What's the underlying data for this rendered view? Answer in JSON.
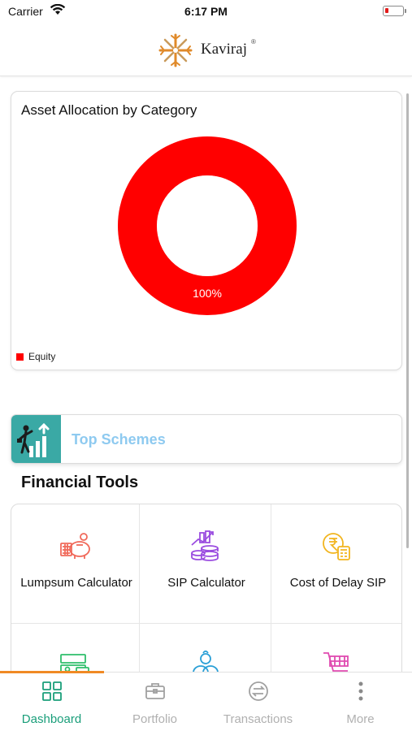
{
  "status_bar": {
    "carrier": "Carrier",
    "time": "6:17 PM"
  },
  "header": {
    "brand": "Kaviraj",
    "brand_mark": "®"
  },
  "allocation": {
    "title": "Asset Allocation by Category",
    "slice_label": "100%",
    "legend": [
      {
        "label": "Equity",
        "color": "#ff0000"
      }
    ]
  },
  "chart_data": {
    "type": "pie",
    "donut": true,
    "title": "Asset Allocation by Category",
    "categories": [
      "Equity"
    ],
    "values": [
      100
    ],
    "colors": [
      "#ff0000"
    ],
    "legend_position": "bottom-left"
  },
  "top_schemes": {
    "label": "Top Schemes",
    "icon": "growth-chart-icon"
  },
  "financial_tools": {
    "title": "Financial Tools",
    "items": [
      {
        "label": "Lumpsum Calculator",
        "icon": "piggy-bank-icon",
        "color": "#f0695a"
      },
      {
        "label": "SIP Calculator",
        "icon": "coins-chart-icon",
        "color": "#9b4de0"
      },
      {
        "label": "Cost of Delay SIP",
        "icon": "rupee-calculator-icon",
        "color": "#f2b51f"
      },
      {
        "label": "",
        "icon": "money-bills-icon",
        "color": "#2fbf6b"
      },
      {
        "label": "",
        "icon": "coin-stack-icon",
        "color": "#2a9fd6"
      },
      {
        "label": "",
        "icon": "shopping-cart-icon",
        "color": "#e04bb0"
      }
    ]
  },
  "tabs": [
    {
      "label": "Dashboard",
      "icon": "grid-icon",
      "active": true
    },
    {
      "label": "Portfolio",
      "icon": "briefcase-icon",
      "active": false
    },
    {
      "label": "Transactions",
      "icon": "exchange-icon",
      "active": false
    },
    {
      "label": "More",
      "icon": "more-dots-icon",
      "active": false
    }
  ],
  "colors": {
    "accent": "#1a9e7a",
    "tab_indicator": "#f08a24",
    "top_schemes_text": "#8ecaf0",
    "inactive_tab": "#b0b0b0"
  }
}
